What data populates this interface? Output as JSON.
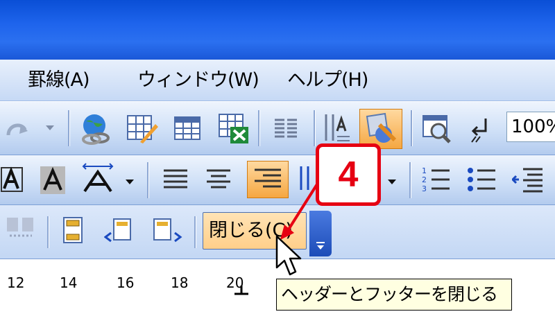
{
  "menu": {
    "items": [
      {
        "label": "罫線(A)"
      },
      {
        "label": "ウィンドウ(W)"
      },
      {
        "label": "ヘルプ(H)"
      }
    ]
  },
  "toolbar": {
    "zoom_value": "100%"
  },
  "header_footer_toolbar": {
    "close_label": "閉じる(C)"
  },
  "ruler": {
    "labels": [
      "12",
      "14",
      "16",
      "18",
      "20"
    ]
  },
  "tooltip": {
    "text": "ヘッダーとフッターを閉じる"
  },
  "callout": {
    "step_number": "4"
  },
  "colors": {
    "callout_red": "#e60012",
    "highlight_orange": "#ffcf8a",
    "tooltip_bg": "#ffffe1"
  }
}
